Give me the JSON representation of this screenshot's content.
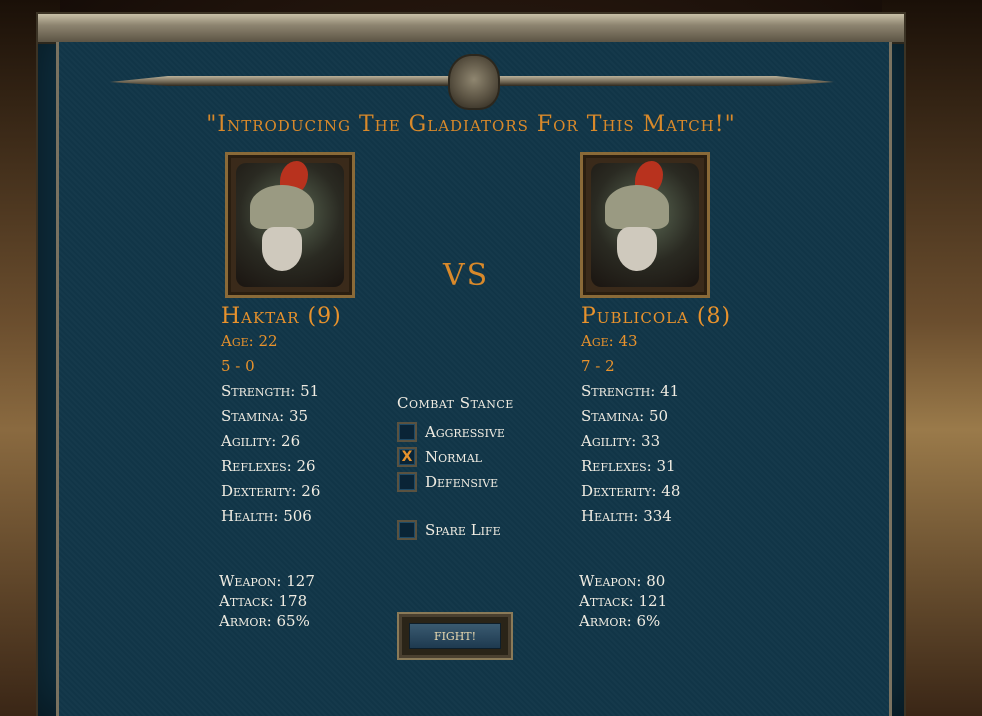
{
  "title": "\"Introducing The Gladiators For This Match!\"",
  "vs_label": "VS",
  "left": {
    "name": "Haktar (9)",
    "age": "Age: 22",
    "record": "5 - 0",
    "stats": [
      "Strength: 51",
      "Stamina: 35",
      "Agility: 26",
      "Reflexes: 26",
      "Dexterity: 26",
      "Health: 506"
    ],
    "gear": [
      "Weapon: 127",
      "Attack: 178",
      "Armor: 65%"
    ]
  },
  "right": {
    "name": "Publicola (8)",
    "age": "Age: 43",
    "record": "7 - 2",
    "stats": [
      "Strength: 41",
      "Stamina: 50",
      "Agility: 33",
      "Reflexes: 31",
      "Dexterity: 48",
      "Health: 334"
    ],
    "gear": [
      "Weapon: 80",
      "Attack: 121",
      "Armor: 6%"
    ]
  },
  "stance": {
    "title": "Combat Stance",
    "options": [
      {
        "label": "Aggressive",
        "mark": ""
      },
      {
        "label": "Normal",
        "mark": "X"
      },
      {
        "label": "Defensive",
        "mark": ""
      }
    ],
    "selected": "Normal"
  },
  "spare_life": {
    "label": "Spare Life",
    "mark": ""
  },
  "fight_button": "FIGHT!",
  "colors": {
    "accent": "#e8922c",
    "panel": "#113648",
    "text": "#f0ece2"
  }
}
